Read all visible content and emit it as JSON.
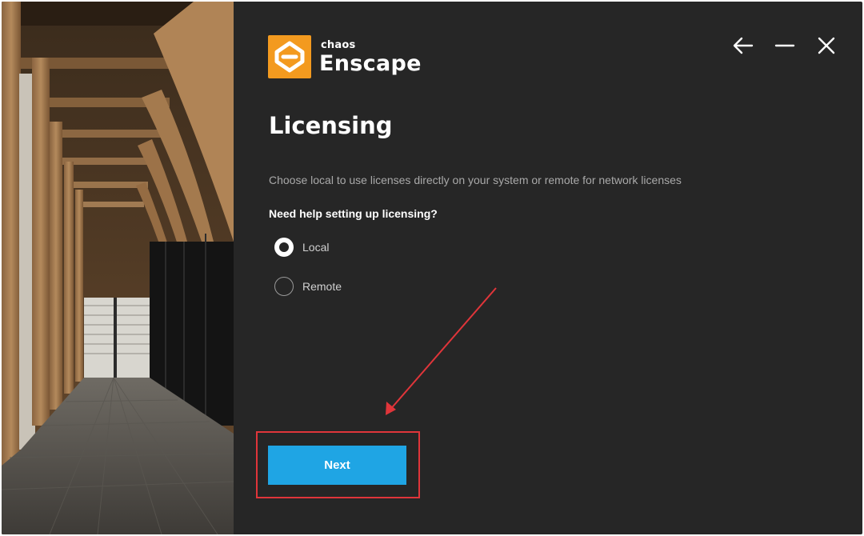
{
  "app": {
    "brand": "chaos",
    "product": "Enscape"
  },
  "page": {
    "title": "Licensing",
    "description": "Choose local to use licenses directly on your system or remote for network licenses",
    "help_text": "Need help setting up licensing?"
  },
  "license_options": [
    {
      "label": "Local",
      "selected": true
    },
    {
      "label": "Remote",
      "selected": false
    }
  ],
  "actions": {
    "next_label": "Next"
  },
  "window_controls": {
    "back_icon": "arrow-left-icon",
    "minimize_icon": "minimize-icon",
    "close_icon": "close-icon"
  },
  "colors": {
    "background": "#262626",
    "accent_orange": "#f39a1f",
    "button_blue": "#1fa5e4",
    "annotation_red": "#e0353a"
  }
}
